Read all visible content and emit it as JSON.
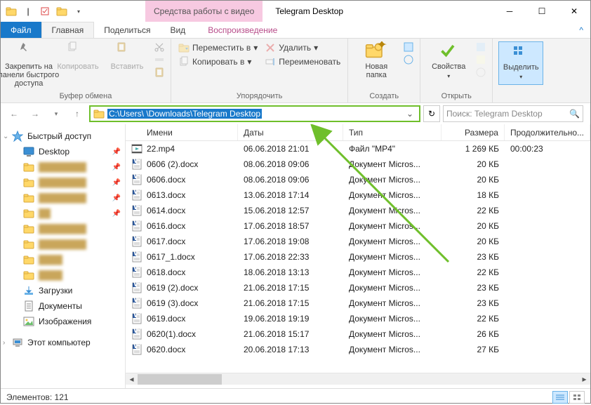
{
  "window": {
    "title": "Telegram Desktop",
    "video_tools": "Средства работы с видео"
  },
  "tabs": {
    "file": "Файл",
    "home": "Главная",
    "share": "Поделиться",
    "view": "Вид",
    "playback": "Воспроизведение"
  },
  "ribbon": {
    "clipboard": {
      "pin": "Закрепить на панели быстрого доступа",
      "copy": "Копировать",
      "paste": "Вставить",
      "label": "Буфер обмена"
    },
    "organize": {
      "move": "Переместить в",
      "copy_to": "Копировать в",
      "delete": "Удалить",
      "rename": "Переименовать",
      "label": "Упорядочить"
    },
    "new": {
      "new_folder": "Новая папка",
      "label": "Создать"
    },
    "open": {
      "properties": "Свойства",
      "label": "Открыть"
    },
    "select": {
      "select": "Выделить",
      "label": ""
    }
  },
  "address": {
    "path": "C:\\Users\\             \\Downloads\\Telegram Desktop"
  },
  "search": {
    "placeholder": "Поиск: Telegram Desktop"
  },
  "sidebar": {
    "quick": "Быстрый доступ",
    "desktop": "Desktop",
    "downloads": "Загрузки",
    "documents": "Документы",
    "pictures": "Изображения",
    "thispc": "Этот компьютер"
  },
  "columns": {
    "name": "Имени",
    "date": "Даты",
    "type": "Тип",
    "size": "Размера",
    "duration": "Продолжительно..."
  },
  "files": [
    {
      "icon": "video",
      "name": "22.mp4",
      "date": "06.06.2018 21:01",
      "type": "Файл \"MP4\"",
      "size": "1 269 КБ",
      "duration": "00:00:23"
    },
    {
      "icon": "docx",
      "name": "0606 (2).docx",
      "date": "08.06.2018 09:06",
      "type": "Документ Micros...",
      "size": "20 КБ",
      "duration": ""
    },
    {
      "icon": "docx",
      "name": "0606.docx",
      "date": "08.06.2018 09:06",
      "type": "Документ Micros...",
      "size": "20 КБ",
      "duration": ""
    },
    {
      "icon": "docx",
      "name": "0613.docx",
      "date": "13.06.2018 17:14",
      "type": "Документ Micros...",
      "size": "18 КБ",
      "duration": ""
    },
    {
      "icon": "docx",
      "name": "0614.docx",
      "date": "15.06.2018 12:57",
      "type": "Документ Micros...",
      "size": "22 КБ",
      "duration": ""
    },
    {
      "icon": "docx",
      "name": "0616.docx",
      "date": "17.06.2018 18:57",
      "type": "Документ Micros...",
      "size": "20 КБ",
      "duration": ""
    },
    {
      "icon": "docx",
      "name": "0617.docx",
      "date": "17.06.2018 19:08",
      "type": "Документ Micros...",
      "size": "20 КБ",
      "duration": ""
    },
    {
      "icon": "docx",
      "name": "0617_1.docx",
      "date": "17.06.2018 22:33",
      "type": "Документ Micros...",
      "size": "23 КБ",
      "duration": ""
    },
    {
      "icon": "docx",
      "name": "0618.docx",
      "date": "18.06.2018 13:13",
      "type": "Документ Micros...",
      "size": "22 КБ",
      "duration": ""
    },
    {
      "icon": "docx",
      "name": "0619 (2).docx",
      "date": "21.06.2018 17:15",
      "type": "Документ Micros...",
      "size": "23 КБ",
      "duration": ""
    },
    {
      "icon": "docx",
      "name": "0619 (3).docx",
      "date": "21.06.2018 17:15",
      "type": "Документ Micros...",
      "size": "23 КБ",
      "duration": ""
    },
    {
      "icon": "docx",
      "name": "0619.docx",
      "date": "19.06.2018 19:19",
      "type": "Документ Micros...",
      "size": "22 КБ",
      "duration": ""
    },
    {
      "icon": "docx",
      "name": "0620(1).docx",
      "date": "21.06.2018 15:17",
      "type": "Документ Micros...",
      "size": "26 КБ",
      "duration": ""
    },
    {
      "icon": "docx",
      "name": "0620.docx",
      "date": "20.06.2018 17:13",
      "type": "Документ Micros...",
      "size": "27 КБ",
      "duration": ""
    }
  ],
  "status": {
    "count": "Элементов: 121"
  }
}
